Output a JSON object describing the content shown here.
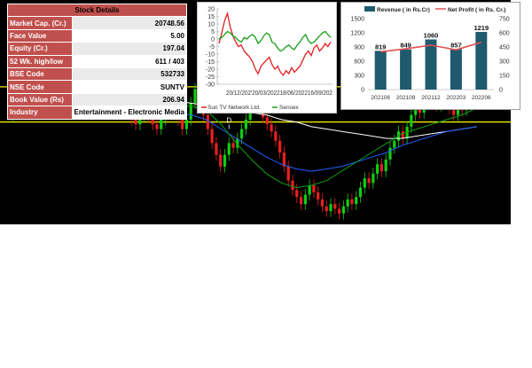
{
  "stock_details": {
    "title": "Stock Details",
    "rows": [
      {
        "label": "Market Cap. (Cr.)",
        "value": "20748.56"
      },
      {
        "label": "Face Value",
        "value": "5.00"
      },
      {
        "label": "Equity (Cr.)",
        "value": "197.04"
      },
      {
        "label": "52 Wk. high/low",
        "value": "611 / 403"
      },
      {
        "label": "BSE Code",
        "value": "532733"
      },
      {
        "label": "NSE Code",
        "value": "SUNTV"
      },
      {
        "label": "Book Value (Rs)",
        "value": "206.94"
      },
      {
        "label": "Industry",
        "value": "Entertainment - Electronic Media"
      }
    ]
  },
  "chart_data": [
    {
      "type": "line",
      "title": "",
      "xlabel": "",
      "ylabel": "",
      "ylim": [
        -30,
        20
      ],
      "yticks": [
        "20",
        "15",
        "10",
        "5",
        "0",
        "-5",
        "-10",
        "-15",
        "-20",
        "-25",
        "-30"
      ],
      "xticks": [
        "20/12/2021",
        "20/03/2022",
        "18/06/2022",
        "16/09/2022"
      ],
      "xtick_labels_visible": "20/12/202'20/03/202218/06/202216/09/202",
      "legend_position": "bottom",
      "series": [
        {
          "name": "Sun TV Network Ltd.",
          "color": "#e02020",
          "values": [
            -3,
            4,
            12,
            17,
            8,
            2,
            -2,
            -5,
            -4,
            -8,
            -10,
            -12,
            -15,
            -20,
            -23,
            -18,
            -16,
            -14,
            -12,
            -17,
            -20,
            -18,
            -22,
            -24,
            -21,
            -23,
            -19,
            -22,
            -20,
            -18,
            -14,
            -10,
            -8,
            -11,
            -6,
            -4,
            -8,
            -6,
            -3,
            -5,
            -2
          ]
        },
        {
          "name": "Sensex",
          "color": "#18a018",
          "values": [
            0,
            1,
            3,
            5,
            4,
            2,
            1,
            -1,
            -2,
            1,
            0,
            2,
            3,
            1,
            -3,
            -1,
            2,
            4,
            3,
            -2,
            -3,
            -6,
            -8,
            -7,
            -5,
            -4,
            -6,
            -7,
            -4,
            -2,
            1,
            3,
            -1,
            -3,
            -2,
            0,
            2,
            4,
            5,
            3,
            1
          ]
        }
      ]
    },
    {
      "type": "bar",
      "title": "",
      "categories": [
        "202106",
        "202109",
        "202112",
        "202203",
        "202206"
      ],
      "ylim": [
        0,
        1500
      ],
      "y2lim": [
        0,
        750
      ],
      "yticks_left": [
        "1500",
        "1200",
        "900",
        "600",
        "300",
        "0"
      ],
      "yticks_right": [
        "750",
        "600",
        "450",
        "300",
        "150",
        "0"
      ],
      "legend_position": "top",
      "series": [
        {
          "name": "Revenue ( in Rs.Cr)",
          "type": "bar",
          "axis": "left",
          "color": "#1f5a6e",
          "values": [
            819,
            849,
            1060,
            857,
            1219
          ]
        },
        {
          "name": "Net Profit ( in Rs. Cr.)",
          "type": "line",
          "axis": "right",
          "color": "#e05050",
          "values": [
            400,
            430,
            470,
            420,
            500
          ]
        }
      ]
    },
    {
      "type": "line",
      "title": "",
      "subtype": "candlestick",
      "colors": {
        "background": "#000000",
        "up": "#10d010",
        "down": "#e82020",
        "ma_white": "#ffffff",
        "ma_blue": "#2060ff",
        "ma_green": "#10a010",
        "level": "#f0f000"
      },
      "annotations": [
        {
          "label": "D",
          "position_index": 16
        },
        {
          "label": "D",
          "position_index": 44
        },
        {
          "label": "D",
          "position_index": 51
        },
        {
          "label": "D",
          "position_index": 95
        }
      ],
      "price_series": [
        {
          "o": 44,
          "c": 46
        },
        {
          "o": 46,
          "c": 50
        },
        {
          "o": 50,
          "c": 55
        },
        {
          "o": 55,
          "c": 60
        },
        {
          "o": 60,
          "c": 54
        },
        {
          "o": 54,
          "c": 58
        },
        {
          "o": 58,
          "c": 64
        },
        {
          "o": 64,
          "c": 68
        },
        {
          "o": 68,
          "c": 62
        },
        {
          "o": 62,
          "c": 58
        },
        {
          "o": 58,
          "c": 55
        },
        {
          "o": 55,
          "c": 60
        },
        {
          "o": 60,
          "c": 70
        },
        {
          "o": 70,
          "c": 78
        },
        {
          "o": 78,
          "c": 85
        },
        {
          "o": 85,
          "c": 80
        },
        {
          "o": 80,
          "c": 72
        },
        {
          "o": 72,
          "c": 64
        },
        {
          "o": 64,
          "c": 58
        },
        {
          "o": 58,
          "c": 52
        },
        {
          "o": 52,
          "c": 47
        },
        {
          "o": 47,
          "c": 53
        },
        {
          "o": 53,
          "c": 60
        },
        {
          "o": 60,
          "c": 64
        },
        {
          "o": 64,
          "c": 59
        },
        {
          "o": 59,
          "c": 54
        },
        {
          "o": 54,
          "c": 49
        },
        {
          "o": 49,
          "c": 45
        },
        {
          "o": 45,
          "c": 42
        },
        {
          "o": 42,
          "c": 40
        },
        {
          "o": 40,
          "c": 44
        },
        {
          "o": 44,
          "c": 47
        },
        {
          "o": 47,
          "c": 43
        },
        {
          "o": 43,
          "c": 40
        },
        {
          "o": 40,
          "c": 38
        },
        {
          "o": 38,
          "c": 42
        },
        {
          "o": 42,
          "c": 47
        },
        {
          "o": 47,
          "c": 50
        },
        {
          "o": 50,
          "c": 46
        },
        {
          "o": 46,
          "c": 42
        },
        {
          "o": 42,
          "c": 38
        },
        {
          "o": 38,
          "c": 42
        },
        {
          "o": 42,
          "c": 49
        },
        {
          "o": 49,
          "c": 55
        },
        {
          "o": 55,
          "c": 50
        },
        {
          "o": 50,
          "c": 44
        },
        {
          "o": 44,
          "c": 38
        },
        {
          "o": 38,
          "c": 32
        },
        {
          "o": 32,
          "c": 27
        },
        {
          "o": 27,
          "c": 22
        },
        {
          "o": 22,
          "c": 27
        },
        {
          "o": 27,
          "c": 32
        },
        {
          "o": 32,
          "c": 30
        },
        {
          "o": 30,
          "c": 34
        },
        {
          "o": 34,
          "c": 38
        },
        {
          "o": 38,
          "c": 42
        },
        {
          "o": 42,
          "c": 48
        },
        {
          "o": 48,
          "c": 56
        },
        {
          "o": 56,
          "c": 50
        },
        {
          "o": 50,
          "c": 43
        },
        {
          "o": 43,
          "c": 40
        },
        {
          "o": 40,
          "c": 37
        },
        {
          "o": 37,
          "c": 33
        },
        {
          "o": 33,
          "c": 28
        },
        {
          "o": 28,
          "c": 22
        },
        {
          "o": 22,
          "c": 16
        },
        {
          "o": 16,
          "c": 12
        },
        {
          "o": 12,
          "c": 9
        },
        {
          "o": 9,
          "c": 6
        },
        {
          "o": 6,
          "c": 10
        },
        {
          "o": 10,
          "c": 14
        },
        {
          "o": 14,
          "c": 11
        },
        {
          "o": 11,
          "c": 8
        },
        {
          "o": 8,
          "c": 5
        },
        {
          "o": 5,
          "c": 3
        },
        {
          "o": 3,
          "c": 6
        },
        {
          "o": 6,
          "c": 4
        },
        {
          "o": 4,
          "c": 2
        },
        {
          "o": 2,
          "c": 5
        },
        {
          "o": 5,
          "c": 8
        },
        {
          "o": 8,
          "c": 6
        },
        {
          "o": 6,
          "c": 9
        },
        {
          "o": 9,
          "c": 13
        },
        {
          "o": 13,
          "c": 17
        },
        {
          "o": 17,
          "c": 15
        },
        {
          "o": 15,
          "c": 19
        },
        {
          "o": 19,
          "c": 23
        },
        {
          "o": 23,
          "c": 20
        },
        {
          "o": 20,
          "c": 25
        },
        {
          "o": 25,
          "c": 30
        },
        {
          "o": 30,
          "c": 33
        },
        {
          "o": 33,
          "c": 37
        },
        {
          "o": 37,
          "c": 34
        },
        {
          "o": 34,
          "c": 39
        },
        {
          "o": 39,
          "c": 44
        },
        {
          "o": 44,
          "c": 48
        },
        {
          "o": 48,
          "c": 45
        },
        {
          "o": 45,
          "c": 50
        },
        {
          "o": 50,
          "c": 54
        },
        {
          "o": 54,
          "c": 51
        },
        {
          "o": 51,
          "c": 48
        },
        {
          "o": 48,
          "c": 53
        },
        {
          "o": 53,
          "c": 50
        },
        {
          "o": 50,
          "c": 47
        },
        {
          "o": 47,
          "c": 44
        },
        {
          "o": 44,
          "c": 49
        },
        {
          "o": 49,
          "c": 46
        },
        {
          "o": 46,
          "c": 52
        },
        {
          "o": 52,
          "c": 56
        },
        {
          "o": 56,
          "c": 60
        }
      ],
      "moving_averages": [
        {
          "color": "#ffffff",
          "values": [
            48,
            49,
            50,
            50,
            51,
            51,
            51,
            51,
            51,
            51,
            50,
            50,
            49,
            48,
            47,
            46,
            45,
            44,
            42,
            41,
            39,
            38,
            37,
            36,
            35,
            34,
            34,
            35,
            36,
            37,
            38,
            39
          ]
        },
        {
          "color": "#2060ff",
          "values": [
            46,
            48,
            50,
            52,
            52,
            52,
            51,
            50,
            48,
            47,
            46,
            45,
            44,
            42,
            38,
            34,
            30,
            26,
            23,
            21,
            20,
            21,
            22,
            24,
            26,
            28,
            31,
            33,
            35,
            37,
            38,
            39
          ]
        },
        {
          "color": "#10a010",
          "values": [
            44,
            50,
            55,
            58,
            57,
            55,
            53,
            50,
            47,
            46,
            45,
            47,
            48,
            46,
            40,
            32,
            25,
            19,
            15,
            13,
            14,
            16,
            20,
            24,
            28,
            32,
            36,
            38,
            40,
            42,
            44,
            47
          ]
        }
      ],
      "levels": [
        56,
        41
      ]
    }
  ]
}
